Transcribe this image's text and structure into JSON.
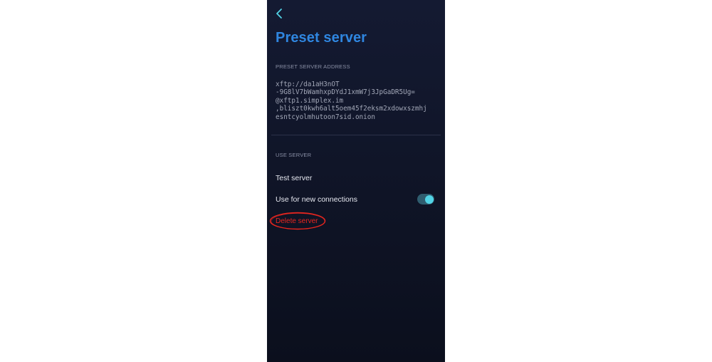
{
  "header": {
    "title": "Preset server"
  },
  "server_address": {
    "section_label": "PRESET SERVER ADDRESS",
    "lines": [
      "xftp://da1aH3nOT",
      "-9G8lV7bWamhxpDYdJ1xmW7j3JpGaDR5Ug=",
      "@xftp1.simplex.im",
      ",bliszt0kwh6alt5oem45f2eksm2xdowxszmhj",
      "esntcyolmhutoon7sid.onion"
    ]
  },
  "use_server": {
    "section_label": "USE SERVER",
    "test_label": "Test server",
    "connections_label": "Use for new connections",
    "connections_enabled": true,
    "delete_label": "Delete server"
  },
  "colors": {
    "title": "#2f86e0",
    "accent": "#52d4e6",
    "danger": "#e8261f",
    "highlight_ring": "#e8261f"
  },
  "icons": {
    "back": "chevron-left-icon",
    "toggle": "toggle-switch"
  }
}
